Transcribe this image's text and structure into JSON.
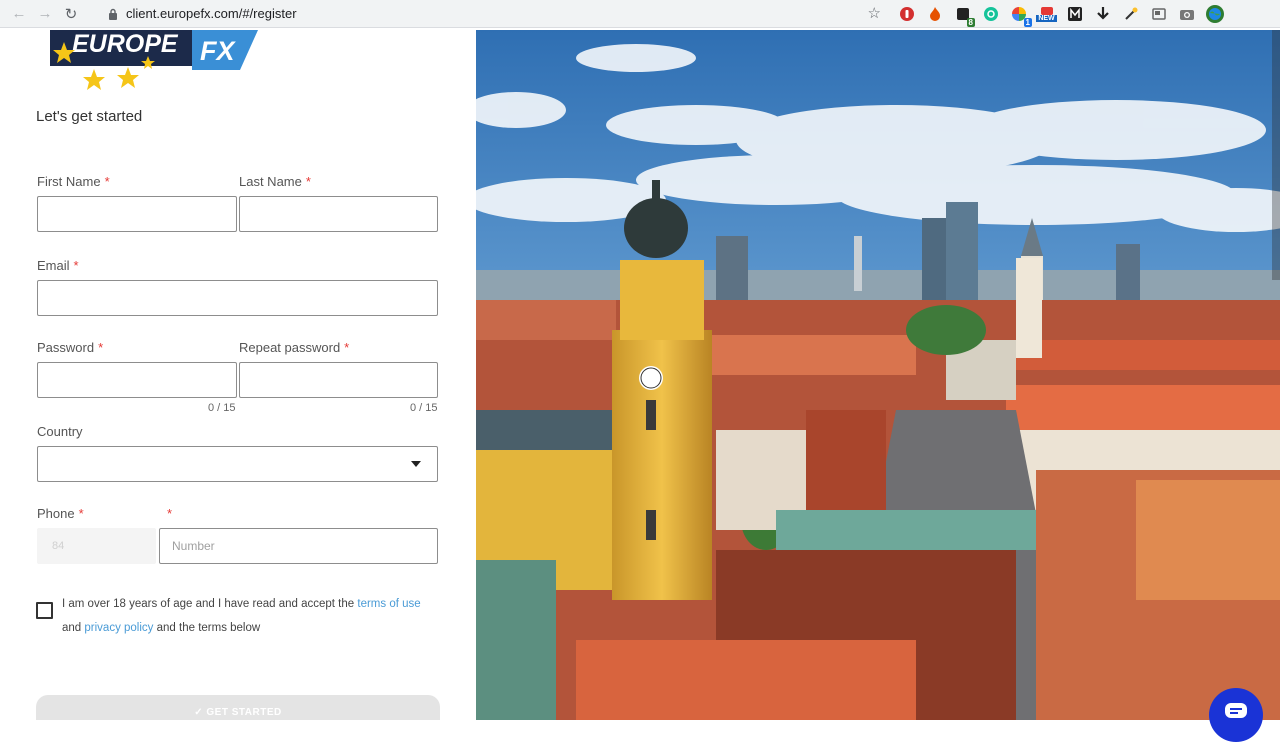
{
  "browser": {
    "url": "client.europefx.com/#/register",
    "back_icon": "back-arrow-icon",
    "forward_icon": "forward-arrow-icon",
    "reload_icon": "reload-icon",
    "extension_badge_new": "NEW",
    "extension_badge_count_a": "8",
    "extension_badge_count_b": "1"
  },
  "brand": {
    "logo_word": "EUROPE",
    "logo_fx": "FX",
    "colors": {
      "navy": "#1c2a4a",
      "blue": "#3a8fd6",
      "gold": "#f5c518"
    }
  },
  "form": {
    "subtitle": "Let's get started",
    "required_mark": "*",
    "first_name_label": "First Name",
    "last_name_label": "Last Name",
    "email_label": "Email",
    "password_label": "Password",
    "repeat_password_label": "Repeat password",
    "password_counter": "0 / 15",
    "repeat_password_counter": "0 / 15",
    "country_label": "Country",
    "country_value": "",
    "phone_label": "Phone",
    "phone_prefix_value": "84",
    "phone_number_placeholder": "Number",
    "terms_text_1": "I am over 18 years of age and I have read and accept the",
    "terms_link_1": "terms of use",
    "terms_text_2": "and",
    "terms_link_2": "privacy policy",
    "terms_text_3": "and the terms below",
    "submit_label": "✓ GET STARTED"
  },
  "colors": {
    "link": "#4a9bd6",
    "required": "#e53935",
    "chat_button": "#1a33d6"
  }
}
